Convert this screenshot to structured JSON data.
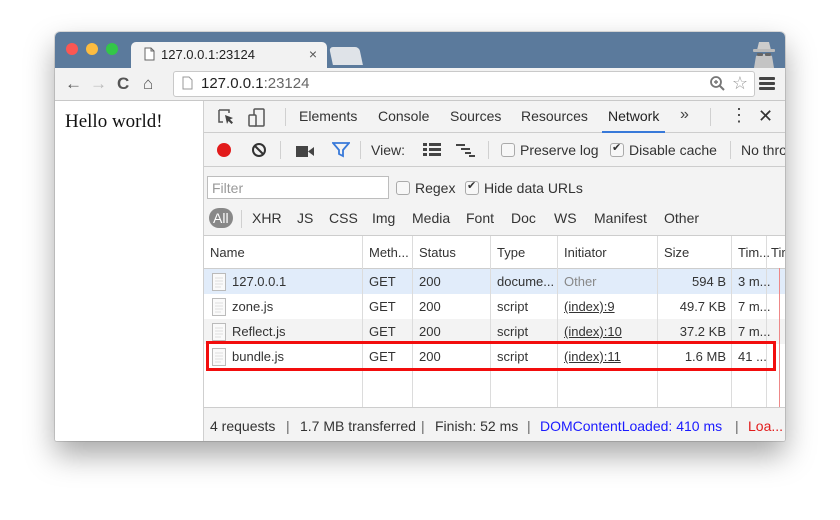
{
  "browser": {
    "tab_title": "127.0.0.1:23124",
    "tab_close": "×",
    "url_host": "127.0.0.1",
    "url_port": ":23124",
    "nav": {
      "back": "←",
      "forward": "→",
      "reload": "C",
      "home": "⌂"
    },
    "star": "☆"
  },
  "page": {
    "heading": "Hello world!"
  },
  "devtools": {
    "tabs": [
      "Elements",
      "Console",
      "Sources",
      "Resources",
      "Network"
    ],
    "active_tab": "Network",
    "more": "»",
    "kebab": "⋮",
    "close": "✕",
    "toolbar": {
      "view_label": "View:",
      "preserve_log": {
        "label": "Preserve log",
        "checked": false
      },
      "disable_cache": {
        "label": "Disable cache",
        "checked": true
      },
      "throttle": "No thro"
    },
    "filter": {
      "placeholder": "Filter",
      "value": "",
      "regex": {
        "label": "Regex",
        "checked": false
      },
      "hide_data_urls": {
        "label": "Hide data URLs",
        "checked": true
      }
    },
    "types": [
      "All",
      "XHR",
      "JS",
      "CSS",
      "Img",
      "Media",
      "Font",
      "Doc",
      "WS",
      "Manifest",
      "Other"
    ],
    "active_type": "All",
    "table": {
      "columns": [
        "Name",
        "Meth...",
        "Status",
        "Type",
        "Initiator",
        "Size",
        "Tim...",
        "Tir"
      ],
      "rows": [
        {
          "name": "127.0.0.1",
          "method": "GET",
          "status": "200",
          "type": "docume...",
          "initiator": "Other",
          "size": "594 B",
          "time": "3 m..."
        },
        {
          "name": "zone.js",
          "method": "GET",
          "status": "200",
          "type": "script",
          "initiator": "(index):9",
          "size": "49.7 KB",
          "time": "7 m..."
        },
        {
          "name": "Reflect.js",
          "method": "GET",
          "status": "200",
          "type": "script",
          "initiator": "(index):10",
          "size": "37.2 KB",
          "time": "7 m..."
        },
        {
          "name": "bundle.js",
          "method": "GET",
          "status": "200",
          "type": "script",
          "initiator": "(index):11",
          "size": "1.6 MB",
          "time": "41 ..."
        }
      ],
      "highlighted_row": "bundle.js"
    },
    "status_bar": {
      "requests": "4 requests",
      "transferred": "1.7 MB transferred",
      "finish": "Finish: 52 ms",
      "dom_content_loaded": "DOMContentLoaded: 410 ms",
      "load": "Loa...",
      "separator": "|"
    },
    "colors": {
      "record": "#e21b1b",
      "active_tab_underline": "#3879d9",
      "dcl": "#1a1aff",
      "load": "#e21b1b",
      "highlight_box": "#f20d0d",
      "selected_row": "#e1ecfa"
    }
  }
}
